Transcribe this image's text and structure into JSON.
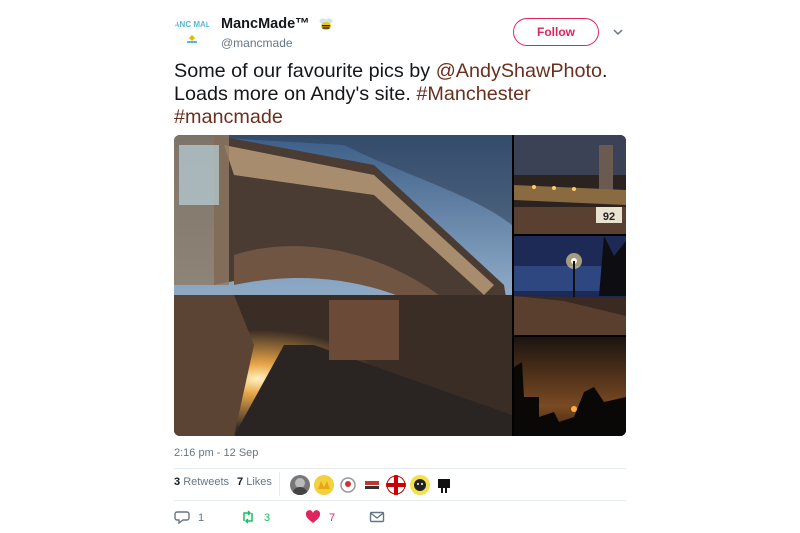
{
  "account": {
    "display_name": "MancMade™",
    "handle": "@mancmade",
    "avatar_label": "MANC MADE",
    "badge_icon": "bee-icon"
  },
  "follow_button": {
    "label": "Follow"
  },
  "tweet": {
    "text_before": "Some of our favourite pics by ",
    "mention": "@AndyShawPhoto",
    "text_middle": ". Loads more on Andy's site. ",
    "hashtag1": "#Manchester",
    "hashtag2": "#mancmade",
    "link_color": "#6b2f1e"
  },
  "media": {
    "photos": [
      "railway-bridge-sunset",
      "canal-night-tower",
      "canal-street-lamp",
      "skyline-dusk-silhouette"
    ],
    "side_photo_sign_text": "92"
  },
  "timestamp": "2:16 pm - 12 Sep",
  "stats": {
    "retweets_count": "3",
    "retweets_label": "Retweets",
    "likes_count": "7",
    "likes_label": "Likes",
    "liker_avatar_count": 7
  },
  "actions": {
    "reply_count": "1",
    "retweet_count": "3",
    "like_count": "7"
  },
  "colors": {
    "follow_accent": "#e0245e",
    "retweet_active": "#17bf63",
    "like_active": "#e0245e",
    "secondary_text": "#657786"
  }
}
